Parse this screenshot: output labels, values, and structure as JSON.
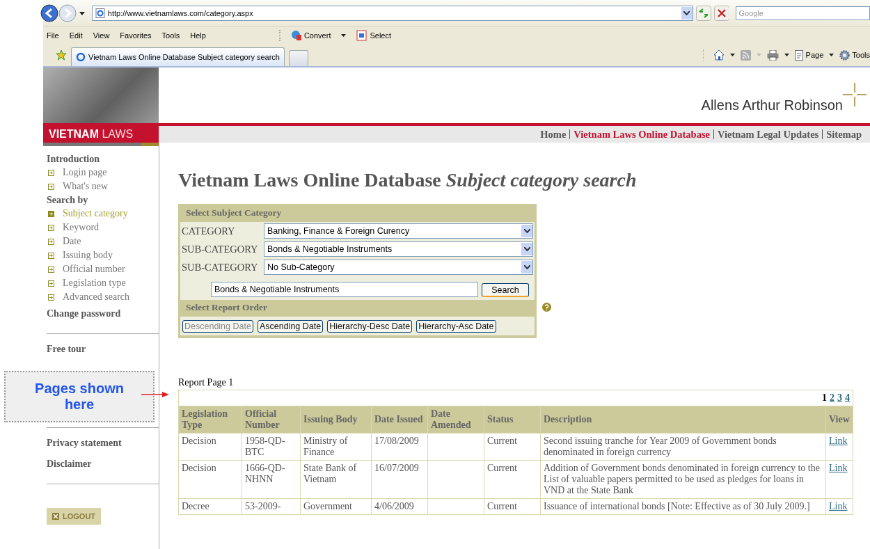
{
  "browser": {
    "address": "http://www.vietnamlaws.com/category.aspx",
    "search_placeholder": "Google",
    "menu": [
      "File",
      "Edit",
      "View",
      "Favorites",
      "Tools",
      "Help"
    ],
    "toolbar": [
      {
        "kind": "convert",
        "label": "Convert"
      },
      {
        "kind": "select",
        "label": "Select"
      }
    ],
    "tab_title": "Vietnam Laws Online Database Subject category search",
    "commands": [
      {
        "kind": "home"
      },
      {
        "kind": "feed"
      },
      {
        "kind": "print"
      },
      {
        "kind": "page",
        "label": "Page"
      },
      {
        "kind": "tools",
        "label": "Tools"
      }
    ]
  },
  "header": {
    "brand": "Allens Arthur Robinson",
    "site": "**VIETNAM** LAWS"
  },
  "nav": [
    {
      "label": "Home",
      "selected": false
    },
    {
      "label": "Vietnam Laws Online Database",
      "selected": true
    },
    {
      "label": "Vietnam Legal Updates",
      "selected": false
    },
    {
      "label": "Sitemap",
      "selected": false
    }
  ],
  "sidebar": {
    "groups": [
      {
        "items": [
          {
            "kind": "heading",
            "label": "Introduction"
          },
          {
            "kind": "link",
            "label": "Login page",
            "selected": false
          },
          {
            "kind": "link",
            "label": "What's new",
            "selected": false
          },
          {
            "kind": "heading",
            "label": "Search by"
          },
          {
            "kind": "link",
            "label": "Subject category",
            "selected": true
          },
          {
            "kind": "link",
            "label": "Keyword",
            "selected": false
          },
          {
            "kind": "link",
            "label": "Date",
            "selected": false
          },
          {
            "kind": "link",
            "label": "Issuing body",
            "selected": false
          },
          {
            "kind": "link",
            "label": "Official number",
            "selected": false
          },
          {
            "kind": "link",
            "label": "Legislation type",
            "selected": false
          },
          {
            "kind": "link",
            "label": "Advanced search",
            "selected": false
          },
          {
            "kind": "page",
            "label": "Change password"
          }
        ]
      },
      {
        "items": [
          {
            "kind": "page",
            "label": "Free tour"
          }
        ]
      },
      {
        "items": [
          {
            "kind": "page",
            "label": "Privacy statement"
          },
          {
            "kind": "page",
            "label": "Disclaimer"
          }
        ]
      }
    ],
    "logout": "LOGOUT"
  },
  "title": "Vietnam Laws Online Database *Subject category search*",
  "form": {
    "heading": "Select Subject Category",
    "selects": [
      {
        "label": "CATEGORY",
        "value": "Banking, Finance & Foreign Curency"
      },
      {
        "label": "SUB-CATEGORY",
        "value": "Bonds & Negotiable Instruments"
      },
      {
        "label": "SUB-CATEGORY",
        "value": "No Sub-Category"
      }
    ],
    "search_value": "Bonds & Negotiable Instruments",
    "search_button": "Search",
    "order_heading": "Select Report Order",
    "orders": [
      {
        "label": "Descending Date",
        "selected": true
      },
      {
        "label": "Ascending Date",
        "selected": false
      },
      {
        "label": "Hierarchy-Desc Date",
        "selected": false
      },
      {
        "label": "Hierarchy-Asc Date",
        "selected": false
      }
    ]
  },
  "report": {
    "title": "Report Page 1",
    "pages": [
      {
        "label": "1",
        "selected": true
      },
      {
        "label": "2",
        "selected": false
      },
      {
        "label": "3",
        "selected": false
      },
      {
        "label": "4",
        "selected": false
      }
    ],
    "columns": [
      "Legislation Type",
      "Official Number",
      "Issuing Body",
      "Date Issued",
      "Date Amended",
      "Status",
      "Description",
      "View"
    ],
    "rows": [
      {
        "type": "Decision",
        "number": "1958-QD-BTC",
        "body": "Ministry of Finance",
        "issued": "17/08/2009",
        "status": "Current",
        "description": "Second issuing tranche for Year 2009 of Government bonds denominated in foreign currency",
        "view": "Link"
      },
      {
        "type": "Decision",
        "number": "1666-QD-NHNN",
        "body": "State Bank of Vietnam",
        "issued": "16/07/2009",
        "status": "Current",
        "description": "Addition of Government bonds denominated in foreign currency to the List of valuable papers permitted to be used as pledges for loans in VND at the State Bank",
        "view": "Link"
      },
      {
        "type": "Decree",
        "number": "53-2009-",
        "body": "Government",
        "issued": "4/06/2009",
        "status": "Current",
        "description": "Issuance of international bonds [Note: Effective as of 30 July 2009.]",
        "view": "Link"
      }
    ]
  },
  "callout": "Pages shown here"
}
